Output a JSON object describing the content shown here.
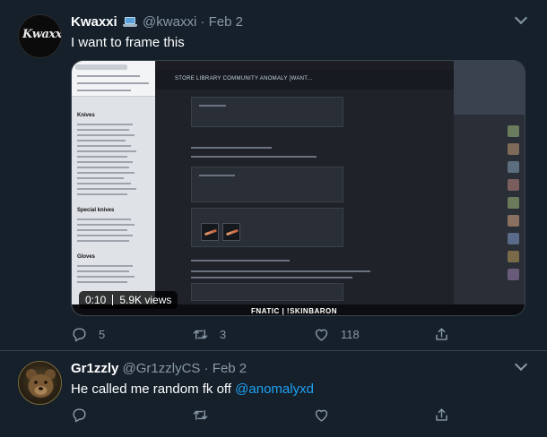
{
  "tweets": [
    {
      "display_name": "Kwaxxi",
      "handle": "@kwaxxi",
      "date": "Feb 2",
      "avatar_text": "Kwaxxi",
      "text": "I want to frame this",
      "video": {
        "time": "0:10",
        "views": "5.9K views",
        "embedded_text": {
          "steam_nav": "STORE   LIBRARY   COMMUNITY   ANOMALY [WANT...",
          "sheet_section_1": "Knives",
          "sheet_section_2": "Special knives",
          "sheet_section_3": "Gloves",
          "watermark": "FNATIC | !SKINBARON"
        }
      },
      "actions": {
        "reply_count": "5",
        "retweet_count": "3",
        "like_count": "118"
      }
    },
    {
      "display_name": "Gr1zzly",
      "handle": "@Gr1zzlyCS",
      "date": "Feb 2",
      "text_before_mention": "He called me random fk off ",
      "mention": "@anomalyxd",
      "actions": {
        "reply_count": "",
        "retweet_count": "",
        "like_count": ""
      }
    }
  ],
  "icons": {
    "source": "laptop-icon",
    "menu": "chevron-down-icon",
    "reply": "reply-icon",
    "retweet": "retweet-icon",
    "like": "heart-icon",
    "share": "share-icon"
  },
  "colors": {
    "background": "#15202b",
    "secondary_text": "#8899a6",
    "link": "#1da1f2",
    "divider": "#38444d"
  }
}
